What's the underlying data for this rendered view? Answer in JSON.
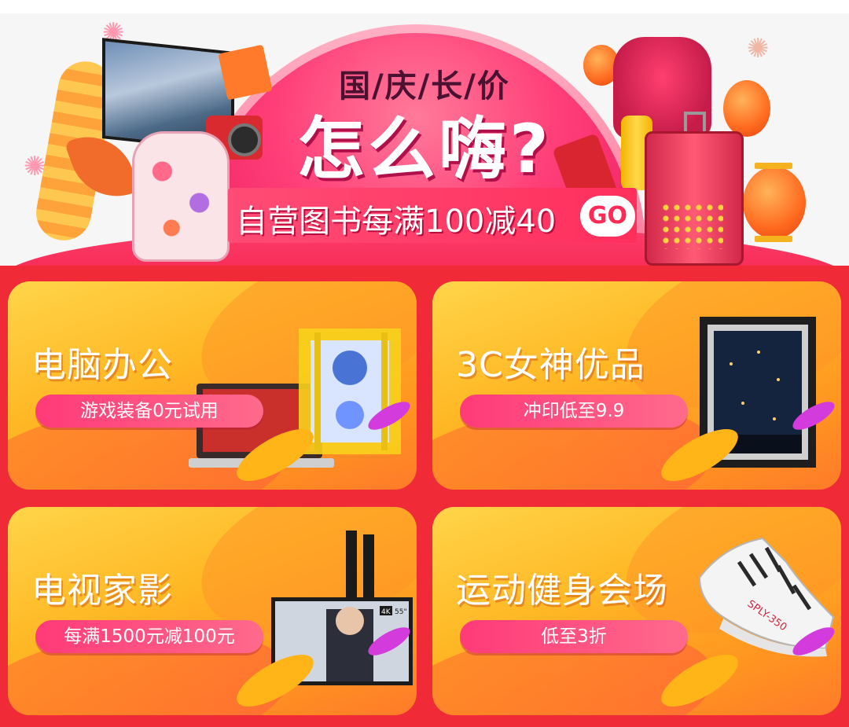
{
  "banner": {
    "subtitle": "国/庆/长/价",
    "headline": "怎么嗨?",
    "promo_text": "自营图书每满100减40",
    "go_label": "GO"
  },
  "cards": [
    {
      "title": "电脑办公",
      "subtitle": "游戏装备0元试用",
      "art": "laptop-and-pc-case"
    },
    {
      "title": "3C女神优品",
      "subtitle": "冲印低至9.9",
      "art": "framed-photo"
    },
    {
      "title": "电视家影",
      "subtitle": "每满1500元减100元",
      "art": "television"
    },
    {
      "title": "运动健身会场",
      "subtitle": "低至3折",
      "art": "sneaker",
      "sneaker_text": "SPLY-350"
    }
  ],
  "tv_screen": {
    "badge": "4K",
    "size": "55\""
  },
  "colors": {
    "banner_pink": "#ff3f78",
    "stage_red": "#f2224a",
    "cards_bg": "#f02a36",
    "card_yellow": "#ffd54a",
    "pill_pink": "#ff3a78"
  }
}
